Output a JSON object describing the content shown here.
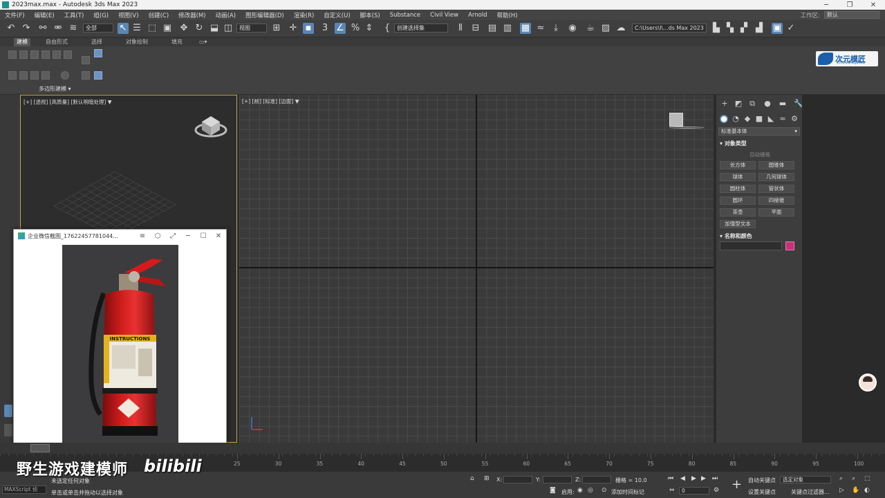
{
  "window": {
    "title": "2023max.max - Autodesk 3ds Max 2023"
  },
  "menu": {
    "items": [
      "文件(F)",
      "编辑(E)",
      "工具(T)",
      "组(G)",
      "视图(V)",
      "创建(C)",
      "修改器(M)",
      "动画(A)",
      "图形编辑器(D)",
      "渲染(R)",
      "自定义(U)",
      "脚本(S)",
      "Substance",
      "Civil View",
      "Arnold",
      "帮助(H)"
    ],
    "workspace_label": "工作区:",
    "workspace_value": "默认"
  },
  "toolbar": {
    "filter_value": "全部",
    "refcoord_value": "视图",
    "selset_placeholder": "创建选择集",
    "path_value": "C:\\Users\\l\\...ds Max 2023"
  },
  "ribbon": {
    "tabs": [
      "建模",
      "自由形式",
      "选择",
      "对象绘制",
      "填充"
    ],
    "active_tab": "建模",
    "panel_label": "多边形建模"
  },
  "logo": {
    "text": "次元模匠",
    "sub": "CIYUANMOJIANG"
  },
  "viewports": {
    "perspective_label": "[+] [透视] [高质量] [默认明暗处理]",
    "top_label": "[+] [前] [标准] [边面]"
  },
  "command_panel": {
    "category": "标准基本体",
    "object_type_title": "对象类型",
    "autogrid": "自动栅格",
    "buttons": [
      "长方体",
      "圆锥体",
      "球体",
      "几何球体",
      "圆柱体",
      "管状体",
      "圆环",
      "四棱锥",
      "茶壶",
      "平面",
      "加强型文本"
    ],
    "name_color_title": "名称和颜色",
    "color": "#c8317a"
  },
  "popup": {
    "title": "企业微信截图_17622457781044...",
    "product_label": "INSTRUCTIONS"
  },
  "timeline": {
    "ticks": [
      "25",
      "30",
      "35",
      "40",
      "45",
      "50",
      "55",
      "60",
      "65",
      "70",
      "75",
      "80",
      "85",
      "90",
      "95",
      "100"
    ]
  },
  "status": {
    "maxscript": "MAXScript 侦",
    "line1": "未选定任何对象",
    "line2": "单击或单击并拖动以选择对象",
    "x_label": "X:",
    "y_label": "Y:",
    "z_label": "Z:",
    "grid": "栅格 = 10.0",
    "enable": "启用:",
    "add_time_tag": "添加时间标记",
    "auto_key": "自动关键点",
    "set_key": "设置关键点",
    "selected_object": "选定对象",
    "key_filters": "关键点过滤器...",
    "frame_value": "0"
  },
  "watermark": {
    "text": "野生游戏建模师",
    "brand": "bilibili"
  }
}
